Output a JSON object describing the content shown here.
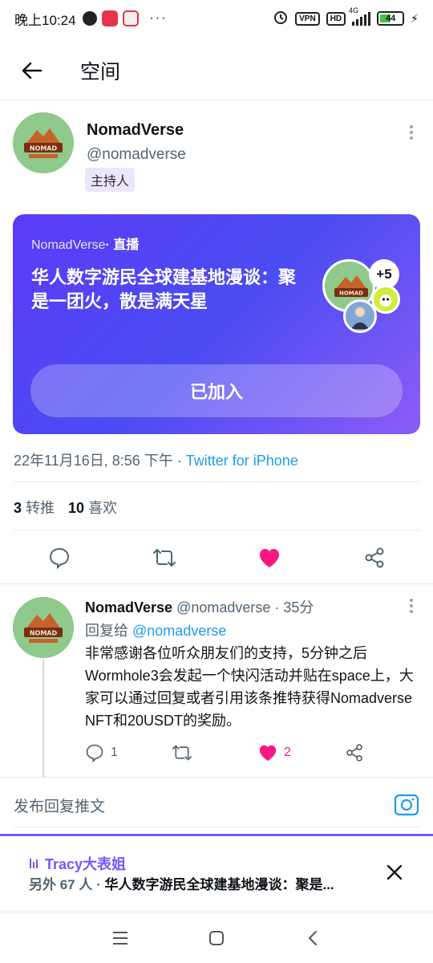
{
  "status": {
    "time": "晚上10:24",
    "vpn": "VPN",
    "hd": "HD",
    "network": "4G",
    "battery": "44"
  },
  "header": {
    "title": "空间"
  },
  "host": {
    "name": "NomadVerse",
    "handle": "@nomadverse",
    "badge": "主持人"
  },
  "space": {
    "account": "NomadVerse",
    "status": "· 直播",
    "title": "华人数字游民全球建基地漫谈：聚是一团火，散是满天星",
    "plus": "+5",
    "joined_button": "已加入"
  },
  "tweet": {
    "datetime": "22年11月16日, 8:56 下午 · ",
    "source": "Twitter for iPhone",
    "retweets_count": "3",
    "retweets_label": "转推",
    "likes_count": "10",
    "likes_label": "喜欢"
  },
  "reply": {
    "name": "NomadVerse",
    "handle_time": "@nomadverse · 35分",
    "replying_to_prefix": "回复给",
    "replying_to": "@nomadverse",
    "body": "非常感谢各位听众朋友们的支持，5分钟之后Wormhole3会发起一个快闪活动并贴在space上，大家可以通过回复或者引用该条推特获得Nomadverse NFT和20USDT的奖励。",
    "reply_count": "1",
    "like_count": "2"
  },
  "compose": {
    "placeholder": "发布回复推文"
  },
  "mini_player": {
    "host": "Tracy大表姐",
    "others": "另外 67 人 · ",
    "title": "华人数字游民全球建基地漫谈：聚是..."
  },
  "colors": {
    "accent_blue": "#1d9bf0",
    "like_pink": "#f91880",
    "space_purple": "#7856ff",
    "avatar_green": "#8fc98b"
  }
}
